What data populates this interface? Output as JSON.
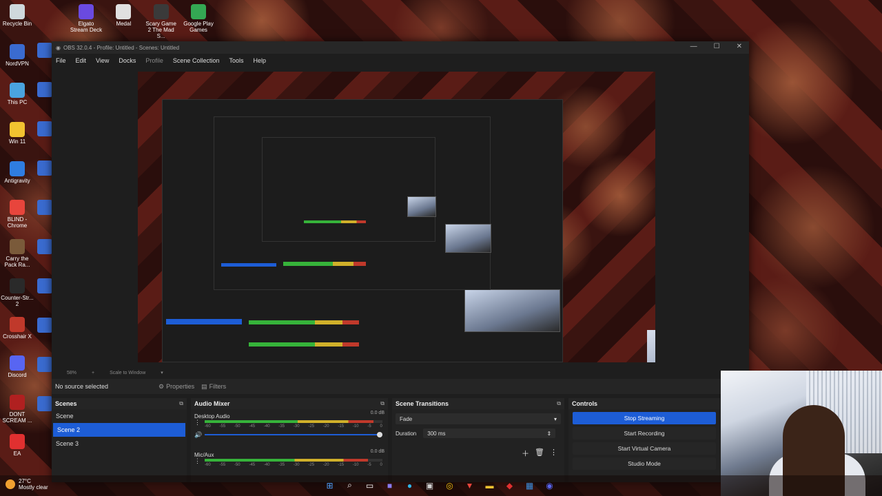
{
  "desktop": {
    "left_icons": [
      {
        "label": "Recycle Bin",
        "color": "#cfd8dc"
      },
      {
        "label": "NordVPN",
        "color": "#3a6bd0"
      },
      {
        "label": "This PC",
        "color": "#4aa3df"
      },
      {
        "label": "Win 11",
        "color": "#f2c230"
      },
      {
        "label": "Antigravity",
        "color": "#2f7de0"
      },
      {
        "label": "BLIND - Chrome",
        "color": "#e8453c"
      },
      {
        "label": "Carry the Pack Ra...",
        "color": "#7a5a3a"
      },
      {
        "label": "Counter-Str... 2",
        "color": "#2a2a2a"
      },
      {
        "label": "Crosshair X",
        "color": "#c0392b"
      },
      {
        "label": "Discord",
        "color": "#5865f2"
      },
      {
        "label": "DONT SCREAM ...",
        "color": "#b02020"
      },
      {
        "label": "EA",
        "color": "#e03030"
      }
    ],
    "top_icons": [
      {
        "label": "Elgato Stream Deck",
        "color": "#6a4ae0"
      },
      {
        "label": "Medal",
        "color": "#e0e0e0"
      },
      {
        "label": "Scary Game 2 The Mad S...",
        "color": "#3a3a3a"
      },
      {
        "label": "Google Play Games",
        "color": "#34a853"
      }
    ]
  },
  "obs": {
    "title": "OBS 32.0.4 - Profile: Untitled - Scenes: Untitled",
    "menu": [
      "File",
      "Edit",
      "View",
      "Docks",
      "Profile",
      "Scene Collection",
      "Tools",
      "Help"
    ],
    "window_buttons": {
      "minimize": "—",
      "maximize": "☐",
      "close": "✕"
    },
    "zoom": "58%",
    "scale_mode": "Scale to Window",
    "no_source": "No source selected",
    "properties_label": "Properties",
    "filters_label": "Filters",
    "scenes": {
      "title": "Scenes",
      "items": [
        "Scene",
        "Scene 2",
        "Scene 3"
      ],
      "selected": "Scene 2"
    },
    "mixer": {
      "title": "Audio Mixer",
      "tracks": [
        {
          "name": "Desktop Audio",
          "db": "0.0 dB",
          "level": 0.95
        },
        {
          "name": "Mic/Aux",
          "db": "0.0 dB",
          "level": 0.92
        }
      ],
      "ticks": [
        "-60",
        "-55",
        "-50",
        "-45",
        "-40",
        "-35",
        "-30",
        "-25",
        "-20",
        "-15",
        "-10",
        "-5",
        "0"
      ]
    },
    "transitions": {
      "title": "Scene Transitions",
      "type": "Fade",
      "duration_label": "Duration",
      "duration": "300 ms"
    },
    "controls": {
      "title": "Controls",
      "buttons": [
        "Stop Streaming",
        "Start Recording",
        "Start Virtual Camera",
        "Studio Mode"
      ]
    }
  },
  "taskbar": {
    "temperature": "27°C",
    "weather": "Mostly clear",
    "icons": [
      "windows-start",
      "search",
      "task-view",
      "teams",
      "edge",
      "store",
      "chrome",
      "valorant",
      "file-explorer",
      "red-app",
      "blue-app",
      "discord"
    ]
  },
  "colors": {
    "accent": "#1d5dd6",
    "panel": "#222222",
    "bg": "#1e1e1e"
  }
}
